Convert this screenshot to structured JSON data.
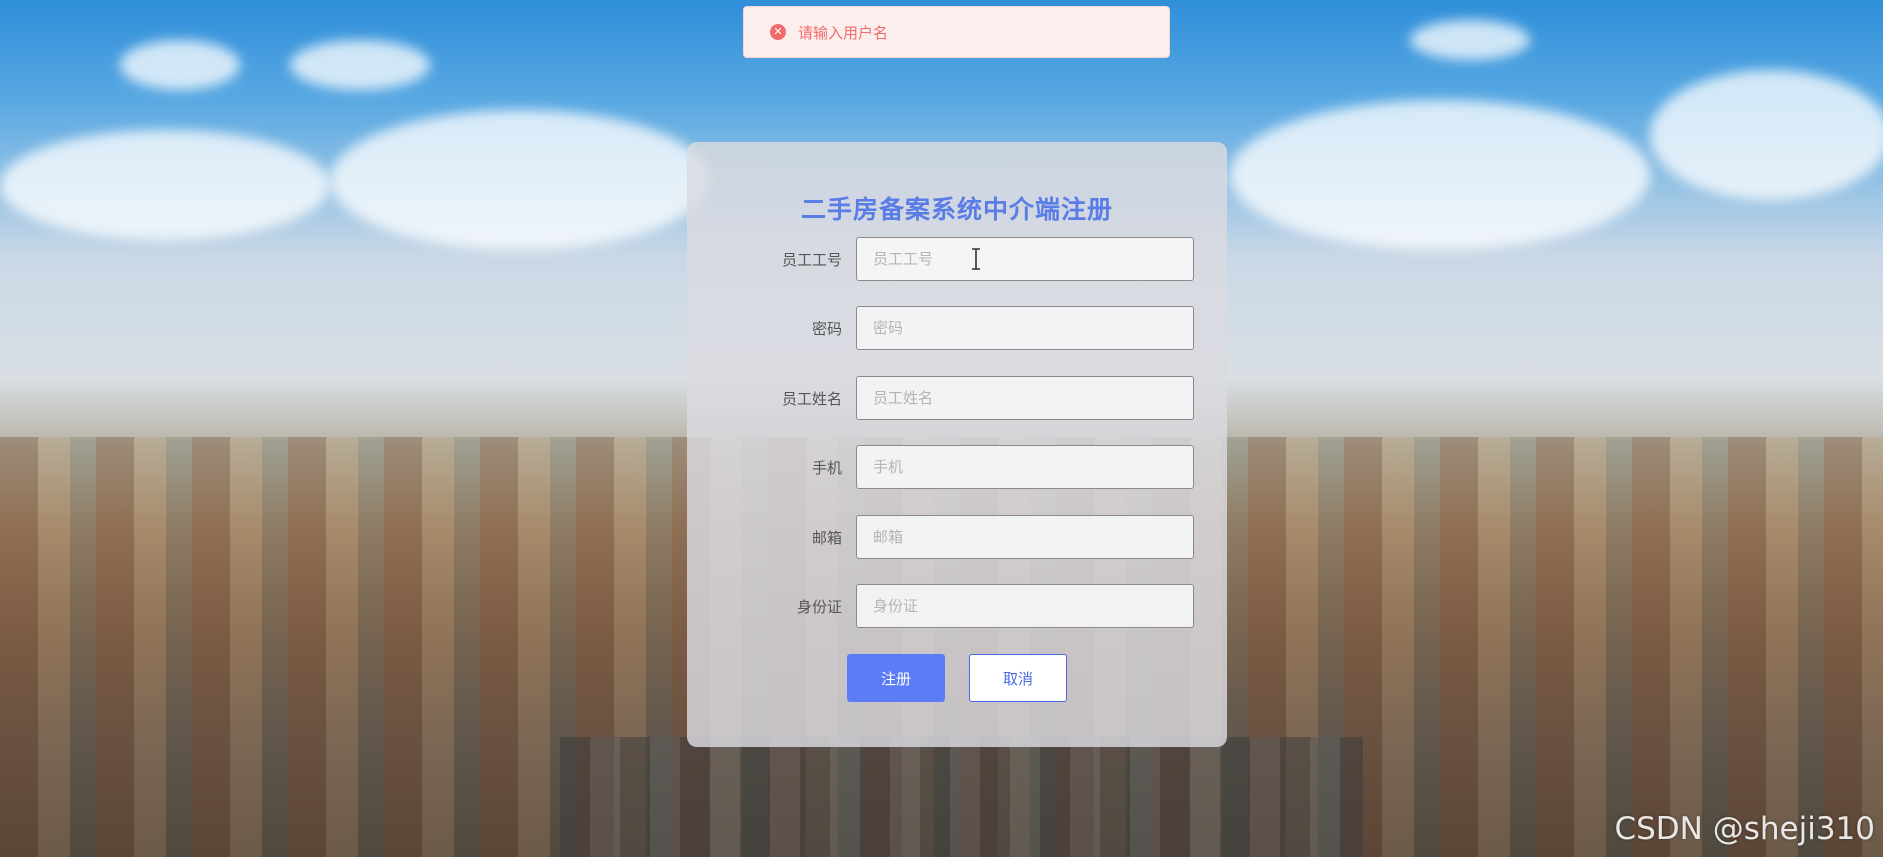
{
  "toast": {
    "icon": "error-circle-icon",
    "message": "请输入用户名",
    "color": "#f06c6c"
  },
  "form": {
    "title": "二手房备案系统中介端注册",
    "fields": [
      {
        "label": "员工工号",
        "placeholder": "员工工号",
        "value": ""
      },
      {
        "label": "密码",
        "placeholder": "密码",
        "value": ""
      },
      {
        "label": "员工姓名",
        "placeholder": "员工姓名",
        "value": ""
      },
      {
        "label": "手机",
        "placeholder": "手机",
        "value": ""
      },
      {
        "label": "邮箱",
        "placeholder": "邮箱",
        "value": ""
      },
      {
        "label": "身份证",
        "placeholder": "身份证",
        "value": ""
      }
    ],
    "register_label": "注册",
    "cancel_label": "取消"
  },
  "colors": {
    "accent": "#5b7cf5",
    "title": "#5a7ce6"
  },
  "watermark": "CSDN @sheji310"
}
